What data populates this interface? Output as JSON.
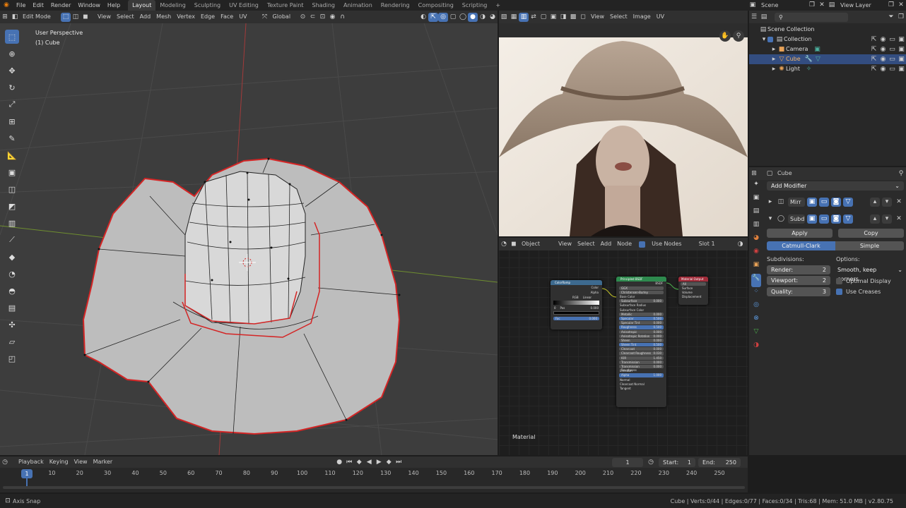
{
  "topbar": {
    "menus": [
      "File",
      "Edit",
      "Render",
      "Window",
      "Help"
    ],
    "workspaces": [
      "Layout",
      "Modeling",
      "Sculpting",
      "UV Editing",
      "Texture Paint",
      "Shading",
      "Animation",
      "Rendering",
      "Compositing",
      "Scripting"
    ],
    "active_workspace": "Layout",
    "add_workspace": "+",
    "scene": "Scene",
    "view_layer": "View Layer"
  },
  "viewport": {
    "mode": "Edit Mode",
    "menus": [
      "View",
      "Select",
      "Add",
      "Mesh",
      "Vertex",
      "Edge",
      "Face",
      "UV"
    ],
    "orientation": "Global",
    "overlay_title": "User Perspective",
    "overlay_object": "(1) Cube"
  },
  "image_editor": {
    "menus": [
      "View",
      "Select",
      "Image",
      "UV"
    ]
  },
  "node_editor": {
    "object_dropdown": "Object",
    "menus": [
      "View",
      "Select",
      "Add",
      "Node"
    ],
    "use_nodes_label": "Use Nodes",
    "slot": "Slot 1",
    "material_label": "Material",
    "colorramp": {
      "title": "ColorRamp",
      "outputs": [
        "Color",
        "Alpha"
      ],
      "mode": "RGB",
      "interp": "Linear",
      "pos_index": "0",
      "pos_label": "Pos",
      "pos_value": "0.000",
      "fac_label": "Fac",
      "fac_value": "0.000"
    },
    "bsdf": {
      "title": "Principled BSDF",
      "output": "BSDF",
      "dist": "GGX",
      "sss": "Christensen-Burley",
      "rows": [
        [
          "Base Color",
          ""
        ],
        [
          "Subsurface",
          "0.000"
        ],
        [
          "Subsurface Radius",
          ""
        ],
        [
          "Subsurface Color",
          ""
        ],
        [
          "Metallic",
          "0.000"
        ],
        [
          "Specular",
          "0.500"
        ],
        [
          "Specular Tint",
          "0.000"
        ],
        [
          "Roughness",
          "0.500"
        ],
        [
          "Anisotropic",
          "0.000"
        ],
        [
          "Anisotropic Rotation",
          "0.000"
        ],
        [
          "Sheen",
          "0.000"
        ],
        [
          "Sheen Tint",
          "0.500"
        ],
        [
          "Clearcoat",
          "0.000"
        ],
        [
          "Clearcoat Roughness",
          "0.030"
        ],
        [
          "IOR",
          "1.450"
        ],
        [
          "Transmission",
          "0.000"
        ],
        [
          "Transmission Roughness",
          "0.000"
        ],
        [
          "Emission",
          ""
        ],
        [
          "Alpha",
          "1.000"
        ],
        [
          "Normal",
          ""
        ],
        [
          "Clearcoat Normal",
          ""
        ],
        [
          "Tangent",
          ""
        ]
      ]
    },
    "output": {
      "title": "Material Output",
      "target": "All",
      "inputs": [
        "Surface",
        "Volume",
        "Displacement"
      ]
    }
  },
  "outliner": {
    "scene_collection": "Scene Collection",
    "collection": "Collection",
    "items": [
      {
        "label": "Camera",
        "color": "#e8a257"
      },
      {
        "label": "Cube",
        "color": "#e8a257"
      },
      {
        "label": "Light",
        "color": "#e8a257"
      }
    ]
  },
  "properties": {
    "object": "Cube",
    "add_modifier": "Add Modifier",
    "modifier1": "Mirr",
    "modifier2": "Subd",
    "apply": "Apply",
    "copy": "Copy",
    "tab_active": "Catmull-Clark",
    "tab_other": "Simple",
    "subdivisions_label": "Subdivisions:",
    "options_label": "Options:",
    "render_label": "Render:",
    "render_value": "2",
    "viewport_label": "Viewport:",
    "viewport_value": "2",
    "quality_label": "Quality:",
    "quality_value": "3",
    "uv_smooth": "Smooth, keep corners",
    "optimal_display": "Optimal Display",
    "use_creases": "Use Creases"
  },
  "timeline": {
    "menus": [
      "Playback",
      "Keying",
      "View",
      "Marker"
    ],
    "current_frame": "1",
    "start_label": "Start:",
    "start": "1",
    "end_label": "End:",
    "end": "250",
    "ticks": [
      "1",
      "10",
      "20",
      "30",
      "40",
      "50",
      "60",
      "70",
      "80",
      "90",
      "100",
      "110",
      "120",
      "130",
      "140",
      "150",
      "160",
      "170",
      "180",
      "190",
      "200",
      "210",
      "220",
      "230",
      "240",
      "250"
    ]
  },
  "statusbar": {
    "left": "Axis Snap",
    "right": "Cube | Verts:0/44 | Edges:0/77 | Faces:0/34 | Tris:68 | Mem: 51.0 MB | v2.80.75"
  },
  "colors": {
    "accent": "#4772b3",
    "selected_edge": "#d42525",
    "grid_red": "#a33a3a",
    "grid_green": "#6f8e2f"
  }
}
